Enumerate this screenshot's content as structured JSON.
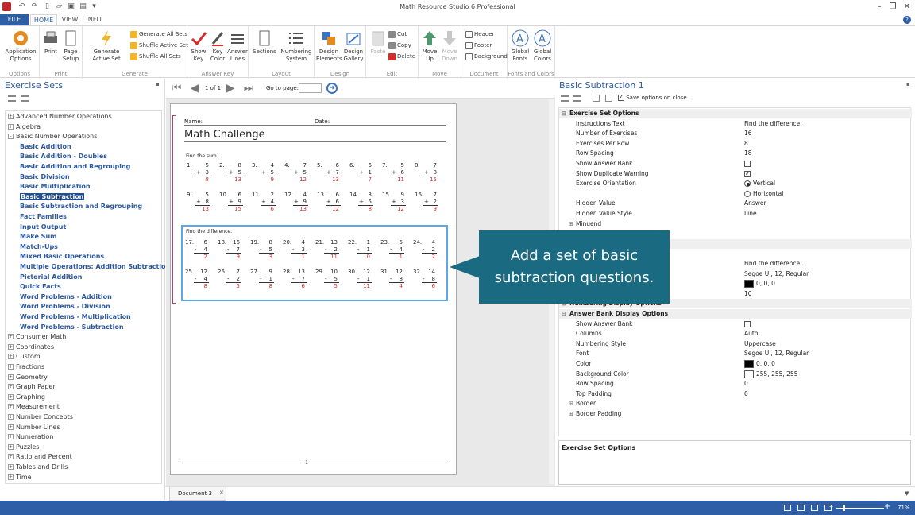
{
  "app_title": "Math Resource Studio 6 Professional",
  "tabs": {
    "file": "FILE",
    "home": "HOME",
    "view": "VIEW",
    "info": "INFO"
  },
  "colors": {
    "accent": "#2d5ea6",
    "callout": "#1a6a82",
    "answer": "#d42b2b"
  },
  "ribbon": {
    "options": {
      "btn": "Application Options",
      "group": "Options"
    },
    "print": {
      "print": "Print",
      "page_setup": "Page Setup",
      "group": "Print"
    },
    "generate": {
      "active": "Generate Active Set",
      "all_sets": "Generate All Sets",
      "shuffle_active": "Shuffle Active Set",
      "shuffle_all": "Shuffle All Sets",
      "group": "Generate"
    },
    "answer_key": {
      "show_key": "Show Key",
      "key_color": "Key Color",
      "answer_lines": "Answer Lines",
      "group": "Answer Key"
    },
    "layout": {
      "sections": "Sections",
      "numbering": "Numbering System",
      "group": "Layout"
    },
    "design": {
      "elements": "Design Elements",
      "gallery": "Design Gallery",
      "group": "Design"
    },
    "edit": {
      "paste": "Paste",
      "cut": "Cut",
      "copy": "Copy",
      "delete": "Delete",
      "group": "Edit"
    },
    "move": {
      "up": "Move Up",
      "down": "Move Down",
      "group": "Move"
    },
    "document": {
      "header": "Header",
      "footer": "Footer",
      "background": "Background",
      "group": "Document"
    },
    "fonts": {
      "global_fonts": "Global Fonts",
      "global_colors": "Global Colors",
      "group": "Fonts and Colors"
    }
  },
  "left_panel": {
    "title": "Exercise Sets",
    "tree": [
      {
        "label": "Advanced Number Operations",
        "level": 0,
        "exp": "+"
      },
      {
        "label": "Algebra",
        "level": 0,
        "exp": "+"
      },
      {
        "label": "Basic Number Operations",
        "level": 0,
        "exp": "-"
      },
      {
        "label": "Basic Addition",
        "level": 1
      },
      {
        "label": "Basic Addition - Doubles",
        "level": 1
      },
      {
        "label": "Basic Addition and Regrouping",
        "level": 1
      },
      {
        "label": "Basic Division",
        "level": 1
      },
      {
        "label": "Basic Multiplication",
        "level": 1
      },
      {
        "label": "Basic Subtraction",
        "level": 1,
        "selected": true
      },
      {
        "label": "Basic Subtraction and Regrouping",
        "level": 1
      },
      {
        "label": "Fact Families",
        "level": 1
      },
      {
        "label": "Input Output",
        "level": 1
      },
      {
        "label": "Make Sum",
        "level": 1
      },
      {
        "label": "Match-Ups",
        "level": 1
      },
      {
        "label": "Mixed Basic Operations",
        "level": 1
      },
      {
        "label": "Multiple Operations: Addition Subtraction",
        "level": 1
      },
      {
        "label": "Pictorial Addition",
        "level": 1
      },
      {
        "label": "Quick Facts",
        "level": 1
      },
      {
        "label": "Word Problems - Addition",
        "level": 1
      },
      {
        "label": "Word Problems - Division",
        "level": 1
      },
      {
        "label": "Word Problems - Multiplication",
        "level": 1
      },
      {
        "label": "Word Problems - Subtraction",
        "level": 1
      },
      {
        "label": "Consumer Math",
        "level": 0,
        "exp": "+"
      },
      {
        "label": "Coordinates",
        "level": 0,
        "exp": "+"
      },
      {
        "label": "Custom",
        "level": 0,
        "exp": "+"
      },
      {
        "label": "Fractions",
        "level": 0,
        "exp": "+"
      },
      {
        "label": "Geometry",
        "level": 0,
        "exp": "+"
      },
      {
        "label": "Graph Paper",
        "level": 0,
        "exp": "+"
      },
      {
        "label": "Graphing",
        "level": 0,
        "exp": "+"
      },
      {
        "label": "Measurement",
        "level": 0,
        "exp": "+"
      },
      {
        "label": "Number Concepts",
        "level": 0,
        "exp": "+"
      },
      {
        "label": "Number Lines",
        "level": 0,
        "exp": "+"
      },
      {
        "label": "Numeration",
        "level": 0,
        "exp": "+"
      },
      {
        "label": "Puzzles",
        "level": 0,
        "exp": "+"
      },
      {
        "label": "Ratio and Percent",
        "level": 0,
        "exp": "+"
      },
      {
        "label": "Tables and Drills",
        "level": 0,
        "exp": "+"
      },
      {
        "label": "Time",
        "level": 0,
        "exp": "+"
      }
    ]
  },
  "nav": {
    "page_label": "1 of 1",
    "goto_label": "Go to page:",
    "goto_value": ""
  },
  "worksheet": {
    "name_label": "Name:",
    "date_label": "Date:",
    "title": "Math Challenge",
    "set1_instr": "Find the sum.",
    "set1": [
      {
        "n": "1.",
        "a": "5",
        "b": "3",
        "op": "+",
        "ans": "8"
      },
      {
        "n": "2.",
        "a": "8",
        "b": "5",
        "op": "+",
        "ans": "13"
      },
      {
        "n": "3.",
        "a": "4",
        "b": "5",
        "op": "+",
        "ans": "9"
      },
      {
        "n": "4.",
        "a": "7",
        "b": "5",
        "op": "+",
        "ans": "12"
      },
      {
        "n": "5.",
        "a": "6",
        "b": "7",
        "op": "+",
        "ans": "13"
      },
      {
        "n": "6.",
        "a": "6",
        "b": "1",
        "op": "+",
        "ans": "7"
      },
      {
        "n": "7.",
        "a": "5",
        "b": "6",
        "op": "+",
        "ans": "11"
      },
      {
        "n": "8.",
        "a": "7",
        "b": "8",
        "op": "+",
        "ans": "15"
      },
      {
        "n": "9.",
        "a": "5",
        "b": "8",
        "op": "+",
        "ans": "13"
      },
      {
        "n": "10.",
        "a": "6",
        "b": "9",
        "op": "+",
        "ans": "15"
      },
      {
        "n": "11.",
        "a": "2",
        "b": "4",
        "op": "+",
        "ans": "6"
      },
      {
        "n": "12.",
        "a": "4",
        "b": "9",
        "op": "+",
        "ans": "13"
      },
      {
        "n": "13.",
        "a": "6",
        "b": "6",
        "op": "+",
        "ans": "12"
      },
      {
        "n": "14.",
        "a": "3",
        "b": "5",
        "op": "+",
        "ans": "8"
      },
      {
        "n": "15.",
        "a": "9",
        "b": "3",
        "op": "+",
        "ans": "12"
      },
      {
        "n": "16.",
        "a": "7",
        "b": "2",
        "op": "+",
        "ans": "9"
      }
    ],
    "set2_instr": "Find the difference.",
    "set2": [
      {
        "n": "17.",
        "a": "6",
        "b": "4",
        "op": "-",
        "ans": "2"
      },
      {
        "n": "18.",
        "a": "16",
        "b": "7",
        "op": "-",
        "ans": "9"
      },
      {
        "n": "19.",
        "a": "8",
        "b": "5",
        "op": "-",
        "ans": "3"
      },
      {
        "n": "20.",
        "a": "4",
        "b": "3",
        "op": "-",
        "ans": "1"
      },
      {
        "n": "21.",
        "a": "13",
        "b": "2",
        "op": "-",
        "ans": "11"
      },
      {
        "n": "22.",
        "a": "1",
        "b": "1",
        "op": "-",
        "ans": "0"
      },
      {
        "n": "23.",
        "a": "5",
        "b": "4",
        "op": "-",
        "ans": "1"
      },
      {
        "n": "24.",
        "a": "4",
        "b": "2",
        "op": "-",
        "ans": "2"
      },
      {
        "n": "25.",
        "a": "12",
        "b": "4",
        "op": "-",
        "ans": "8"
      },
      {
        "n": "26.",
        "a": "7",
        "b": "2",
        "op": "-",
        "ans": "5"
      },
      {
        "n": "27.",
        "a": "9",
        "b": "1",
        "op": "-",
        "ans": "8"
      },
      {
        "n": "28.",
        "a": "13",
        "b": "7",
        "op": "-",
        "ans": "6"
      },
      {
        "n": "29.",
        "a": "10",
        "b": "5",
        "op": "-",
        "ans": "5"
      },
      {
        "n": "30.",
        "a": "12",
        "b": "1",
        "op": "-",
        "ans": "11"
      },
      {
        "n": "31.",
        "a": "12",
        "b": "8",
        "op": "-",
        "ans": "4"
      },
      {
        "n": "32.",
        "a": "14",
        "b": "8",
        "op": "-",
        "ans": "6"
      }
    ],
    "footer": "- 1 -"
  },
  "right_panel": {
    "title": "Basic Subtraction 1",
    "save_on_close": "Save options on close",
    "cat_options": "Exercise Set Options",
    "props": [
      {
        "k": "Instructions Text",
        "v": "Find the difference."
      },
      {
        "k": "Number of Exercises",
        "v": "16"
      },
      {
        "k": "Exercises Per Row",
        "v": "8"
      },
      {
        "k": "Row Spacing",
        "v": "18"
      },
      {
        "k": "Show Answer Bank",
        "v": ""
      },
      {
        "k": "Show Duplicate Warning",
        "v": ""
      },
      {
        "k": "Exercise Orientation",
        "v": "Vertical"
      },
      {
        "k": "",
        "v": "Horizontal"
      },
      {
        "k": "Hidden Value",
        "v": "Answer"
      },
      {
        "k": "Hidden Value Style",
        "v": "Line"
      }
    ],
    "minuend": "Minuend",
    "partial_props": [
      {
        "k": "",
        "v": "Find the difference."
      },
      {
        "k": "",
        "v": "Segoe UI, 12, Regular"
      },
      {
        "k": "",
        "v": "0, 0, 0"
      },
      {
        "k": "Bottom Padding",
        "v": "10"
      }
    ],
    "cat_numbering": "Numbering Display Options",
    "cat_answer_bank": "Answer Bank Display Options",
    "ab_props": [
      {
        "k": "Show Answer Bank",
        "v": ""
      },
      {
        "k": "Columns",
        "v": "Auto"
      },
      {
        "k": "Numbering Style",
        "v": "Uppercase"
      },
      {
        "k": "Font",
        "v": "Segoe UI, 12, Regular"
      },
      {
        "k": "Color",
        "v": "0, 0, 0"
      },
      {
        "k": "Background Color",
        "v": "255, 255, 255"
      },
      {
        "k": "Row Spacing",
        "v": "0"
      },
      {
        "k": "Top Padding",
        "v": "0"
      }
    ],
    "border": "Border",
    "border_padding": "Border Padding",
    "desc_title": "Exercise Set Options"
  },
  "doc_tab": "Document 3",
  "zoom": "71%",
  "callout": {
    "line1": "Add a set of basic",
    "line2": "subtraction questions."
  }
}
